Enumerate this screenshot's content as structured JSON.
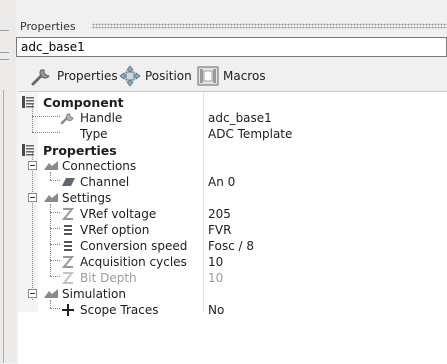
{
  "panel": {
    "title": "Properties"
  },
  "name_field": {
    "value": "adc_base1"
  },
  "toolbar": {
    "properties_label": "Properties",
    "position_label": "Position",
    "macros_label": "Macros"
  },
  "grid": {
    "component": {
      "label": "Component",
      "handle": {
        "name": "Handle",
        "value": "adc_base1"
      },
      "type": {
        "name": "Type",
        "value": "ADC Template"
      }
    },
    "properties": {
      "label": "Properties",
      "connections": {
        "label": "Connections",
        "channel": {
          "name": "Channel",
          "value": "An 0"
        }
      },
      "settings": {
        "label": "Settings",
        "vref_voltage": {
          "name": "VRef voltage",
          "value": "205"
        },
        "vref_option": {
          "name": "VRef option",
          "value": "FVR"
        },
        "conversion_speed": {
          "name": "Conversion speed",
          "value": "Fosc / 8"
        },
        "acquisition_cycles": {
          "name": "Acquisition cycles",
          "value": "10"
        },
        "bit_depth": {
          "name": "Bit Depth",
          "value": "10",
          "disabled": true
        }
      },
      "simulation": {
        "label": "Simulation",
        "scope_traces": {
          "name": "Scope Traces",
          "value": "No"
        }
      }
    }
  },
  "icons": {
    "properties": "wrench-icon",
    "position": "move-arrows-icon",
    "macros": "macros-icon",
    "category": "property-page-icon",
    "group": "folder-group-icon",
    "numeric": "z-icon",
    "list": "list-icon",
    "channel": "channel-icon",
    "scope": "plus-icon"
  }
}
